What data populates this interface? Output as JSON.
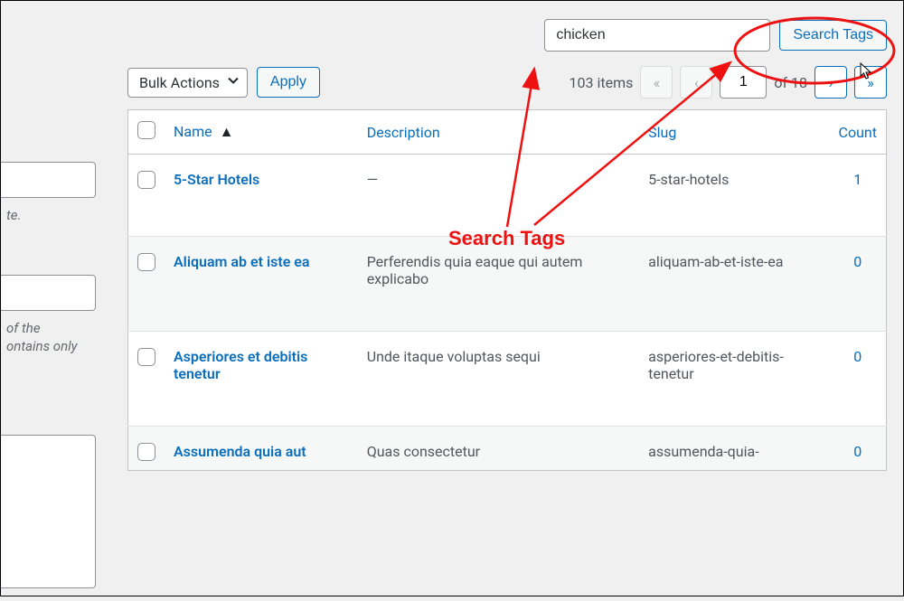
{
  "search": {
    "value": "chicken",
    "button": "Search Tags"
  },
  "bulk": {
    "label": "Bulk Actions",
    "apply": "Apply"
  },
  "pagination": {
    "items_text": "103 items",
    "first": "«",
    "prev": "‹",
    "next": "›",
    "last": "»",
    "current": "1",
    "of_text": "of 18"
  },
  "columns": {
    "name": "Name",
    "desc": "Description",
    "slug": "Slug",
    "count": "Count"
  },
  "rows": [
    {
      "name": "5-Star Hotels",
      "desc": "—",
      "slug": "5-star-hotels",
      "count": "1"
    },
    {
      "name": "Aliquam ab et iste ea",
      "desc": "Perferendis quia eaque qui autem explicabo",
      "slug": "aliquam-ab-et-iste-ea",
      "count": "0"
    },
    {
      "name": "Asperiores et debitis tenetur",
      "desc": "Unde itaque voluptas sequi",
      "slug": "asperiores-et-debitis-tenetur",
      "count": "0"
    },
    {
      "name": "Assumenda quia aut",
      "desc": "Quas consectetur",
      "slug": "assumenda-quia-",
      "count": "0"
    }
  ],
  "left_fragments": {
    "t1": "te.",
    "t2": "of the",
    "t3": "ontains only"
  },
  "annotation": {
    "label": "Search Tags"
  }
}
